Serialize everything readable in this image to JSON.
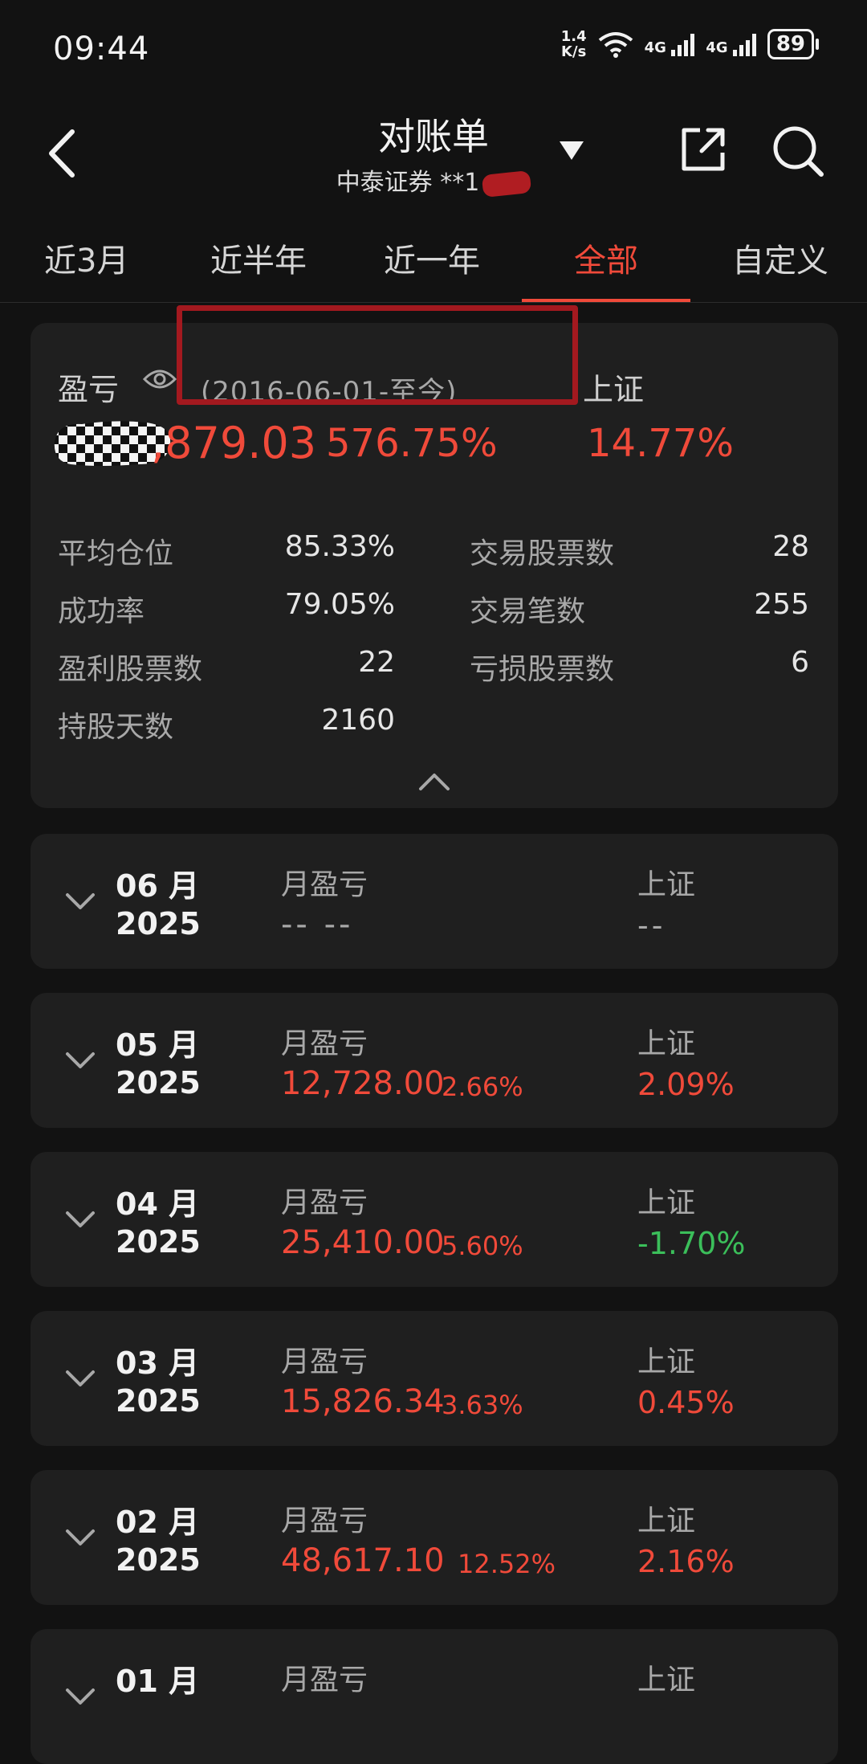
{
  "status_bar": {
    "time": "09:44",
    "net_speed_value": "1.4",
    "net_speed_unit": "K/s",
    "signal1": "4G",
    "signal2": "4G",
    "battery": "89"
  },
  "header": {
    "title": "对账单",
    "subtitle": "中泰证券 **1"
  },
  "tabs": [
    "近3月",
    "近半年",
    "近一年",
    "全部",
    "自定义"
  ],
  "active_tab": "全部",
  "summary": {
    "pnl_label": "盈亏",
    "date_range": "(2016-06-01-至今)",
    "index_label": "上证",
    "pnl_value": ",879.03",
    "pnl_pct": "576.75%",
    "index_pct": "14.77%",
    "stats": [
      {
        "label": "平均仓位",
        "value": "85.33%"
      },
      {
        "label": "交易股票数",
        "value": "28"
      },
      {
        "label": "成功率",
        "value": "79.05%"
      },
      {
        "label": "交易笔数",
        "value": "255"
      },
      {
        "label": "盈利股票数",
        "value": "22"
      },
      {
        "label": "亏损股票数",
        "value": "6"
      },
      {
        "label": "持股天数",
        "value": "2160"
      }
    ]
  },
  "months": [
    {
      "month": "06 月",
      "year": "2025",
      "label": "月盈亏",
      "amount": "-- --",
      "pct": "",
      "index_label": "上证",
      "index": "--",
      "state": "neutral"
    },
    {
      "month": "05 月",
      "year": "2025",
      "label": "月盈亏",
      "amount": "12,728.00",
      "pct": "2.66%",
      "index_label": "上证",
      "index": "2.09%",
      "state": "up"
    },
    {
      "month": "04 月",
      "year": "2025",
      "label": "月盈亏",
      "amount": "25,410.00",
      "pct": "5.60%",
      "index_label": "上证",
      "index": "-1.70%",
      "state": "down"
    },
    {
      "month": "03 月",
      "year": "2025",
      "label": "月盈亏",
      "amount": "15,826.34",
      "pct": "3.63%",
      "index_label": "上证",
      "index": "0.45%",
      "state": "up"
    },
    {
      "month": "02 月",
      "year": "2025",
      "label": "月盈亏",
      "amount": "48,617.10",
      "pct": "12.52%",
      "index_label": "上证",
      "index": "2.16%",
      "state": "up"
    },
    {
      "month": "01 月",
      "year": "",
      "label": "月盈亏",
      "amount": "",
      "pct": "",
      "index_label": "上证",
      "index": "",
      "state": "up"
    }
  ],
  "colors": {
    "up": "#f04a3a",
    "down": "#3bbf5a",
    "accent": "#f04a3a",
    "annotation": "#a3191f"
  }
}
